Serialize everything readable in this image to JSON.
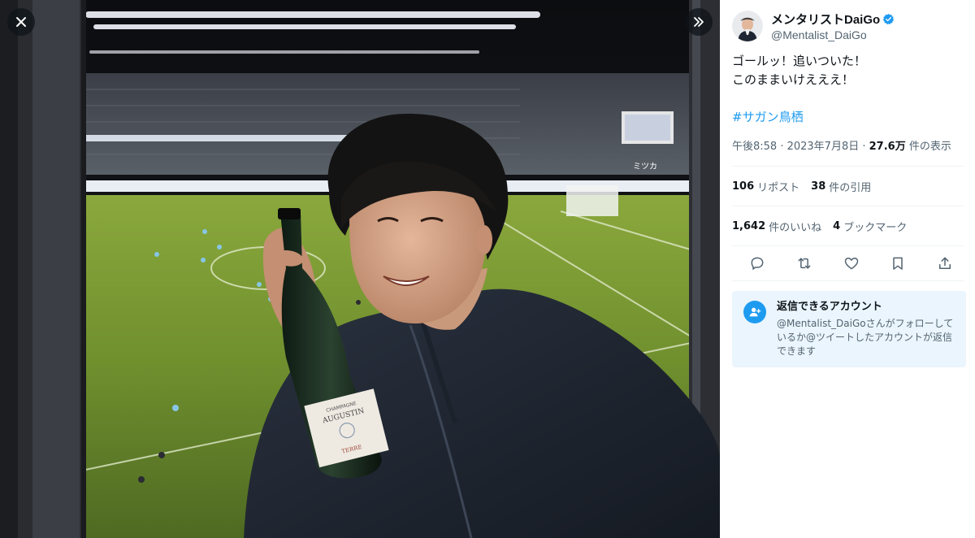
{
  "media": {
    "label_line1": "CHAMPAGNE",
    "label_brand": "AUGUSTIN",
    "label_cuvee": "TERRE",
    "stadium_board": "ミツカ"
  },
  "author": {
    "display_name": "メンタリストDaiGo",
    "handle": "@Mentalist_DaiGo",
    "verified": true
  },
  "tweet": {
    "line1": "ゴールッ！追いついた！",
    "line2": "このままいけえええ！",
    "hashtag": "#サガン鳥栖",
    "time": "午後8:58 · 2023年7月8日 · ",
    "views_count": "27.6万",
    "views_label": " 件の表示"
  },
  "stats": {
    "reposts_count": "106",
    "reposts_label": "リポスト",
    "quotes_count": "38",
    "quotes_label": "件の引用",
    "likes_count": "1,642",
    "likes_label": "件のいいね",
    "bookmarks_count": "4",
    "bookmarks_label": "ブックマーク"
  },
  "reply_notice": {
    "title": "返信できるアカウント",
    "description": "@Mentalist_DaiGoさんがフォローしているか@ツイートしたアカウントが返信できます"
  },
  "colors": {
    "accent": "#1d9bf0",
    "secondary_text": "#536471",
    "reply_box_bg": "#eaf5fd"
  },
  "icons": [
    "close-icon",
    "expand-icon",
    "verified-icon",
    "reply-icon",
    "repost-icon",
    "like-icon",
    "bookmark-icon",
    "share-icon",
    "person-add-icon"
  ]
}
